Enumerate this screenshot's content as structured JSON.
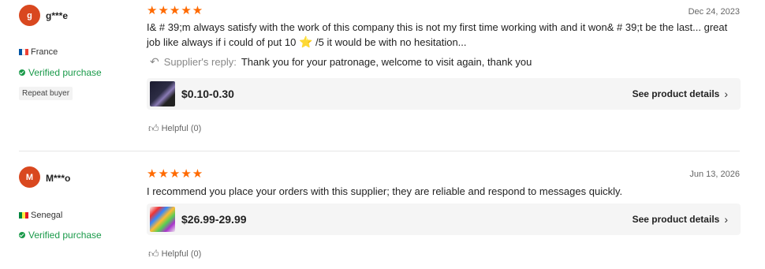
{
  "reviews": [
    {
      "avatar_letter": "g",
      "username": "g***e",
      "country": "France",
      "flag_colors": [
        "#0055a4",
        "#ffffff",
        "#ef4135"
      ],
      "verified": "Verified purchase",
      "badge": "Repeat buyer",
      "rating": 5,
      "stars": "★★★★★",
      "date": "Dec 24, 2023",
      "comment_part1": "I& # 39;m always satisfy with the work of this company this is not my first time working with and it won& # 39;t be the last... great job like always if i could of put 10",
      "comment_emoji": "⭐",
      "comment_part2": "/5 it would be with no hesitation...",
      "reply_label": "Supplier's reply:",
      "reply_text": "Thank you for your patronage, welcome to visit again, thank you",
      "price": "$0.10-0.30",
      "details_label": "See product details",
      "helpful": "Helpful (0)"
    },
    {
      "avatar_letter": "M",
      "username": "M***o",
      "country": "Senegal",
      "flag_colors": [
        "#00853f",
        "#fdef42",
        "#e31b23"
      ],
      "verified": "Verified purchase",
      "rating": 5,
      "stars": "★★★★★",
      "date": "Jun 13, 2026",
      "comment": "I recommend you place your orders with this supplier; they are reliable and respond to messages quickly.",
      "price": "$26.99-29.99",
      "details_label": "See product details",
      "helpful": "Helpful (0)"
    }
  ],
  "colors": {
    "avatar": "#d9481f",
    "stars": "#ff6a00",
    "verified": "#1a9a4a",
    "product_bg": "#f5f5f5"
  },
  "icons": [
    "check-icon",
    "reply-arrow-icon",
    "chevron-right-icon",
    "thumbs-up-icon"
  ]
}
